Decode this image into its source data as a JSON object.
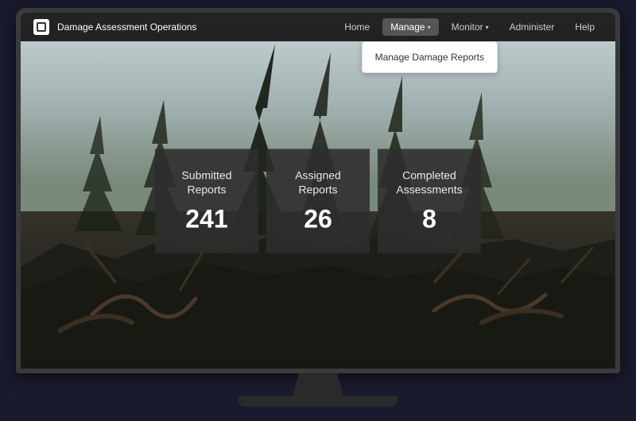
{
  "app": {
    "logo_alt": "home-icon",
    "title": "Damage Assessment Operations"
  },
  "navbar": {
    "home_label": "Home",
    "manage_label": "Manage",
    "monitor_label": "Monitor",
    "administer_label": "Administer",
    "help_label": "Help"
  },
  "dropdown": {
    "manage_damage_reports_label": "Manage Damage Reports"
  },
  "stats": [
    {
      "label": "Submitted Reports",
      "value": "241"
    },
    {
      "label": "Assigned Reports",
      "value": "26"
    },
    {
      "label": "Completed Assessments",
      "value": "8"
    }
  ]
}
